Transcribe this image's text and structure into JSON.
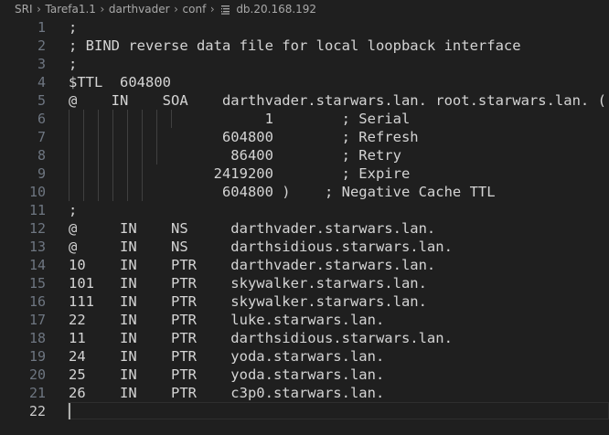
{
  "breadcrumb": {
    "items": [
      "SRI",
      "Tarefa1.1",
      "darthvader",
      "conf"
    ],
    "file": "db.20.168.192",
    "separator": "›"
  },
  "editor": {
    "lines": [
      {
        "num": "1",
        "text": ";"
      },
      {
        "num": "2",
        "text": "; BIND reverse data file for local loopback interface"
      },
      {
        "num": "3",
        "text": ";"
      },
      {
        "num": "4",
        "text": "$TTL  604800"
      },
      {
        "num": "5",
        "text": "@    IN    SOA    darthvader.starwars.lan. root.starwars.lan. ("
      },
      {
        "num": "6",
        "text": "                       1        ; Serial"
      },
      {
        "num": "7",
        "text": "                  604800        ; Refresh"
      },
      {
        "num": "8",
        "text": "                   86400        ; Retry"
      },
      {
        "num": "9",
        "text": "                 2419200        ; Expire"
      },
      {
        "num": "10",
        "text": "                  604800 )    ; Negative Cache TTL"
      },
      {
        "num": "11",
        "text": ";"
      },
      {
        "num": "12",
        "text": "@     IN    NS     darthvader.starwars.lan."
      },
      {
        "num": "13",
        "text": "@     IN    NS     darthsidious.starwars.lan."
      },
      {
        "num": "14",
        "text": "10    IN    PTR    darthvader.starwars.lan."
      },
      {
        "num": "15",
        "text": "101   IN    PTR    skywalker.starwars.lan."
      },
      {
        "num": "16",
        "text": "111   IN    PTR    skywalker.starwars.lan."
      },
      {
        "num": "17",
        "text": "22    IN    PTR    luke.starwars.lan."
      },
      {
        "num": "18",
        "text": "11    IN    PTR    darthsidious.starwars.lan."
      },
      {
        "num": "19",
        "text": "24    IN    PTR    yoda.starwars.lan."
      },
      {
        "num": "20",
        "text": "25    IN    PTR    yoda.starwars.lan."
      },
      {
        "num": "21",
        "text": "26    IN    PTR    c3p0.starwars.lan."
      },
      {
        "num": "22",
        "text": ""
      }
    ],
    "current_line": "22"
  },
  "colors": {
    "background": "#1f1f1f",
    "text": "#d4d4d4",
    "line_number": "#6e7681",
    "current_line_number": "#cccccc",
    "indent_guide": "#404040"
  }
}
